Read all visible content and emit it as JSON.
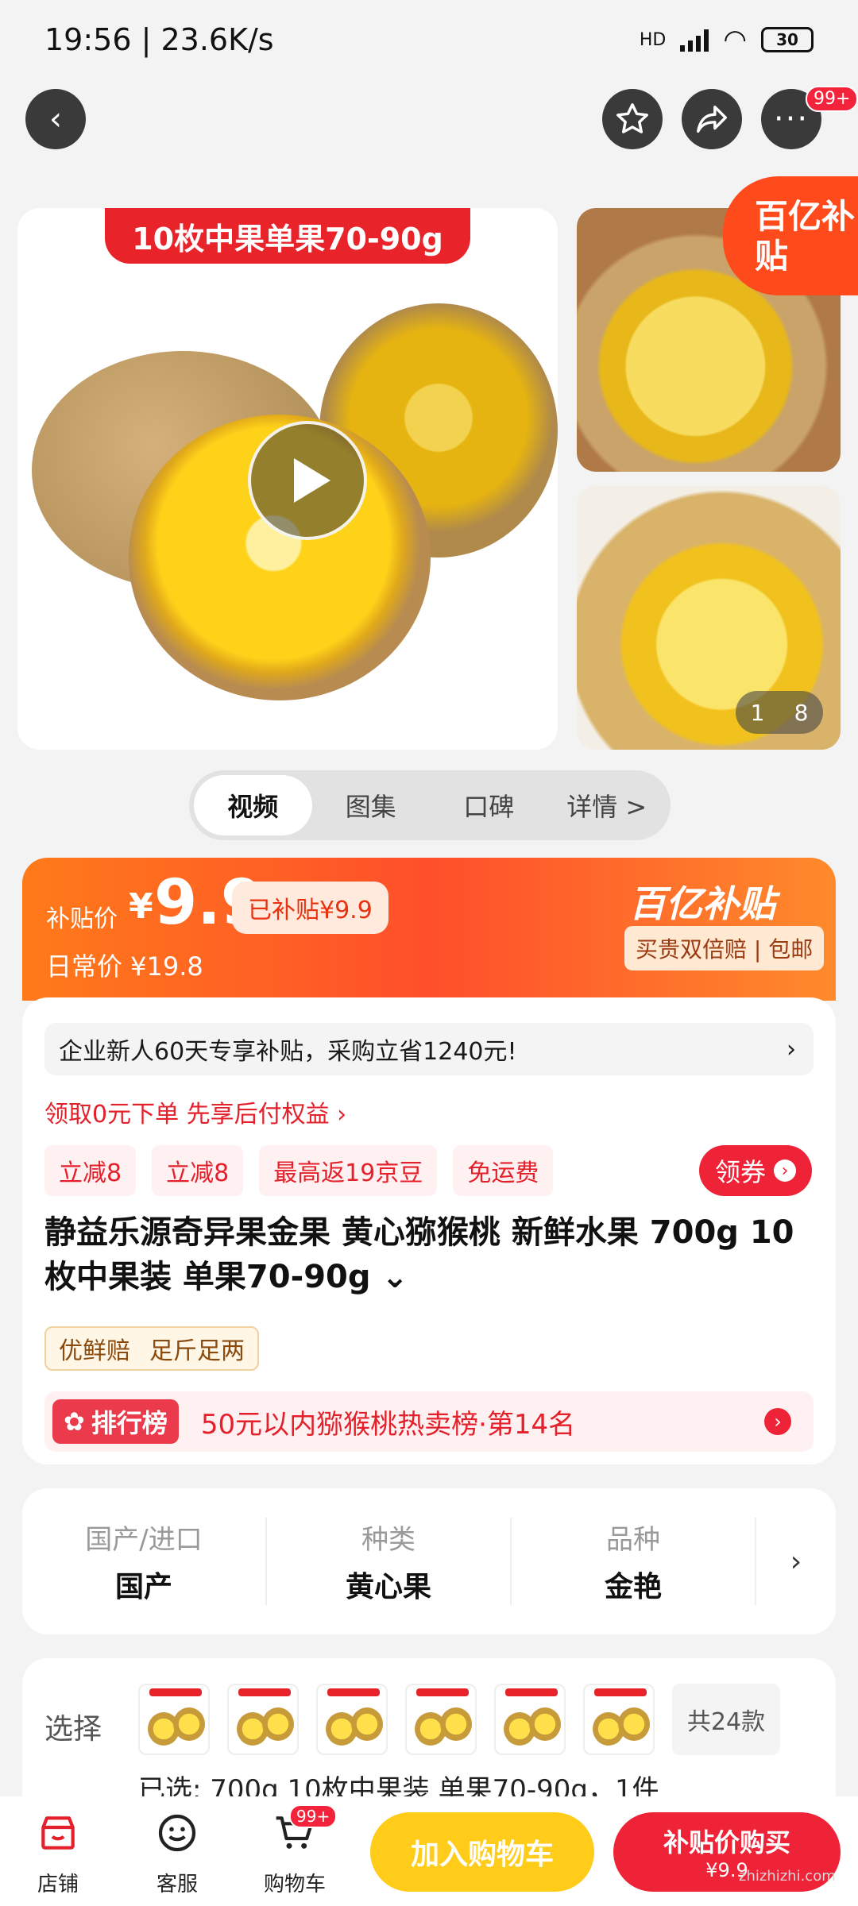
{
  "status": {
    "time": "19:56 | 23.6K/s",
    "battery": "30",
    "hd": "HD"
  },
  "nav": {
    "badge": "99+"
  },
  "gallery": {
    "banner": "10枚中果单果70-90g",
    "promo_badge": "百亿补贴",
    "counter_current": "1",
    "counter_total": "8"
  },
  "tabs": [
    "视频",
    "图集",
    "口碑",
    "详情 >"
  ],
  "price": {
    "label": "补贴价",
    "currency": "¥",
    "amount": "9.9",
    "subsidized": "已补贴¥9.9",
    "daily": "日常价 ¥19.8",
    "brand": "百亿补贴",
    "brand_sub": "买贵双倍赔 | 包邮"
  },
  "info": {
    "notice": "企业新人60天专享补贴，采购立省1240元!",
    "credit": "领取0元下单 先享后付权益 ›",
    "coupons": [
      "立减8",
      "立减8",
      "最高返19京豆",
      "免运费"
    ],
    "get_coupon": "领券",
    "title": "静益乐源奇异果金果 黄心猕猴桃 新鲜水果 700g 10枚中果装 单果70-90g ⌄",
    "tags": [
      "优鲜赔",
      "足斤足两"
    ],
    "rank_tag": "排行榜",
    "rank_text": "50元以内猕猴桃热卖榜·第14名"
  },
  "attributes": [
    {
      "key": "国产/进口",
      "value": "国产"
    },
    {
      "key": "种类",
      "value": "黄心果"
    },
    {
      "key": "品种",
      "value": "金艳"
    }
  ],
  "select": {
    "label": "选择",
    "total": "共24款",
    "chosen": "已选: 700g 10枚中果装 单果70-90g，1件"
  },
  "bottom": {
    "shop": "店铺",
    "service": "客服",
    "cart": "购物车",
    "cart_badge": "99+",
    "add_cart": "加入购物车",
    "buy": "补贴价购买",
    "buy_price": "¥9.9"
  },
  "watermark": "zhizhizhi.com"
}
